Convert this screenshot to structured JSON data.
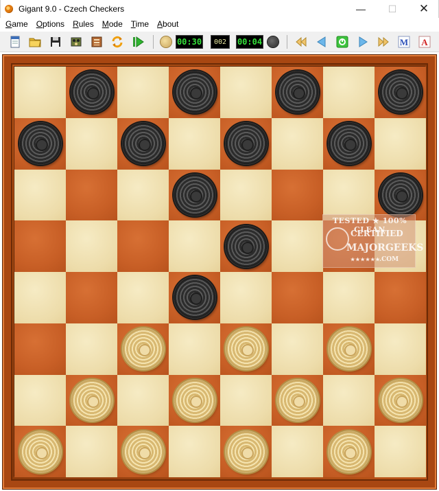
{
  "window": {
    "title": "Gigant 9.0 - Czech Checkers",
    "minimize_glyph": "—",
    "maximize_glyph": "☐",
    "close_glyph": "✕"
  },
  "menu": {
    "items": [
      {
        "label": "Game",
        "underline": "G"
      },
      {
        "label": "Options",
        "underline": "O"
      },
      {
        "label": "Rules",
        "underline": "R"
      },
      {
        "label": "Mode",
        "underline": "M"
      },
      {
        "label": "Time",
        "underline": "T"
      },
      {
        "label": "About",
        "underline": "A"
      }
    ]
  },
  "toolbar": {
    "icons": [
      "new-game-icon",
      "open-folder-icon",
      "save-disk-icon",
      "board-setup-icon",
      "engine-settings-icon",
      "flip-rotate-icon",
      "play-icon",
      "first-move-icon",
      "previous-move-icon",
      "engine-move-icon",
      "next-move-icon",
      "last-move-icon",
      "manual-m-icon",
      "auto-a-icon"
    ],
    "white_timer": "00:30",
    "move_counter": "002",
    "black_timer": "00:04"
  },
  "board": {
    "light_color": "#eddcaa",
    "dark_color": "#c85f26",
    "rows": [
      [
        null,
        "B",
        null,
        "B",
        null,
        "B",
        null,
        "B"
      ],
      [
        "B",
        null,
        "B",
        null,
        "B",
        null,
        "B",
        null
      ],
      [
        null,
        null,
        null,
        "B",
        null,
        null,
        null,
        "B"
      ],
      [
        null,
        null,
        null,
        null,
        "B",
        null,
        null,
        null
      ],
      [
        null,
        null,
        null,
        "B",
        null,
        null,
        null,
        null
      ],
      [
        null,
        null,
        "W",
        null,
        "W",
        null,
        "W",
        null
      ],
      [
        null,
        "W",
        null,
        "W",
        null,
        "W",
        null,
        "W"
      ],
      [
        "W",
        null,
        "W",
        null,
        "W",
        null,
        "W",
        null
      ]
    ]
  },
  "watermark": {
    "line1": "TESTED ★ 100% CLEAN",
    "line2": "CERTIFIED",
    "line3": "MAJORGEEKS",
    "line4": ".COM",
    "stars": "★★★★★★"
  }
}
